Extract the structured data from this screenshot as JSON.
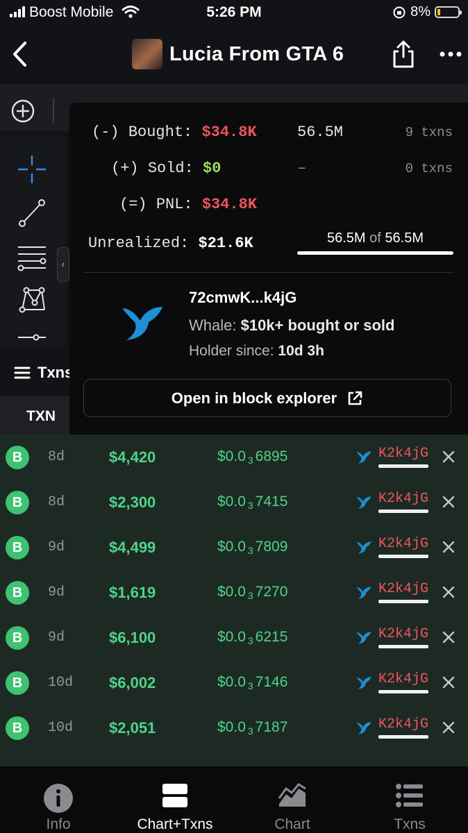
{
  "status_bar": {
    "carrier": "Boost Mobile",
    "time": "5:26 PM",
    "battery": "8%"
  },
  "header": {
    "title": "Lucia From GTA 6"
  },
  "popup": {
    "bought": {
      "prefix": "(-)",
      "label": "Bought:",
      "value": "$34.8K",
      "amount": "56.5M",
      "txns": "9 txns"
    },
    "sold": {
      "prefix": "(+)",
      "label": "Sold:",
      "value": "$0",
      "amount": "–",
      "txns": "0 txns"
    },
    "pnl": {
      "prefix": "(=)",
      "label": "PNL:",
      "value": "$34.8K"
    },
    "unrealized": {
      "label": "Unrealized:",
      "value": "$21.6K",
      "held": "56.5M",
      "of": "of",
      "total": "56.5M",
      "fraction": 1.0
    },
    "wallet": "72cmwK...k4jG",
    "whale_label": "Whale:",
    "whale_value": "$10k+ bought or sold",
    "holder_label": "Holder since:",
    "holder_value": "10d 3h",
    "explorer_button": "Open in block explorer"
  },
  "txns_panel": {
    "label": "Txns",
    "column_txn": "TXN"
  },
  "transactions": [
    {
      "type": "B",
      "age": "8d",
      "amount": "$4,420",
      "price_prefix": "$0.0",
      "price_zeros": "3",
      "price_digits": "6895",
      "maker": "K2k4jG"
    },
    {
      "type": "B",
      "age": "8d",
      "amount": "$2,300",
      "price_prefix": "$0.0",
      "price_zeros": "3",
      "price_digits": "7415",
      "maker": "K2k4jG"
    },
    {
      "type": "B",
      "age": "9d",
      "amount": "$4,499",
      "price_prefix": "$0.0",
      "price_zeros": "3",
      "price_digits": "7809",
      "maker": "K2k4jG"
    },
    {
      "type": "B",
      "age": "9d",
      "amount": "$1,619",
      "price_prefix": "$0.0",
      "price_zeros": "3",
      "price_digits": "7270",
      "maker": "K2k4jG"
    },
    {
      "type": "B",
      "age": "9d",
      "amount": "$6,100",
      "price_prefix": "$0.0",
      "price_zeros": "3",
      "price_digits": "6215",
      "maker": "K2k4jG"
    },
    {
      "type": "B",
      "age": "10d",
      "amount": "$6,002",
      "price_prefix": "$0.0",
      "price_zeros": "3",
      "price_digits": "7146",
      "maker": "K2k4jG"
    },
    {
      "type": "B",
      "age": "10d",
      "amount": "$2,051",
      "price_prefix": "$0.0",
      "price_zeros": "3",
      "price_digits": "7187",
      "maker": "K2k4jG"
    }
  ],
  "bottom_nav": [
    {
      "label": "Info",
      "icon": "info-icon",
      "active": false
    },
    {
      "label": "Chart+Txns",
      "icon": "chart-txns-icon",
      "active": true
    },
    {
      "label": "Chart",
      "icon": "chart-icon",
      "active": false
    },
    {
      "label": "Txns",
      "icon": "txns-list-icon",
      "active": false
    }
  ],
  "colors": {
    "buy_green": "#4fd389",
    "loss_red": "#f0545e",
    "sold_green": "#9be05a",
    "whale_blue": "#1f8fd6"
  }
}
